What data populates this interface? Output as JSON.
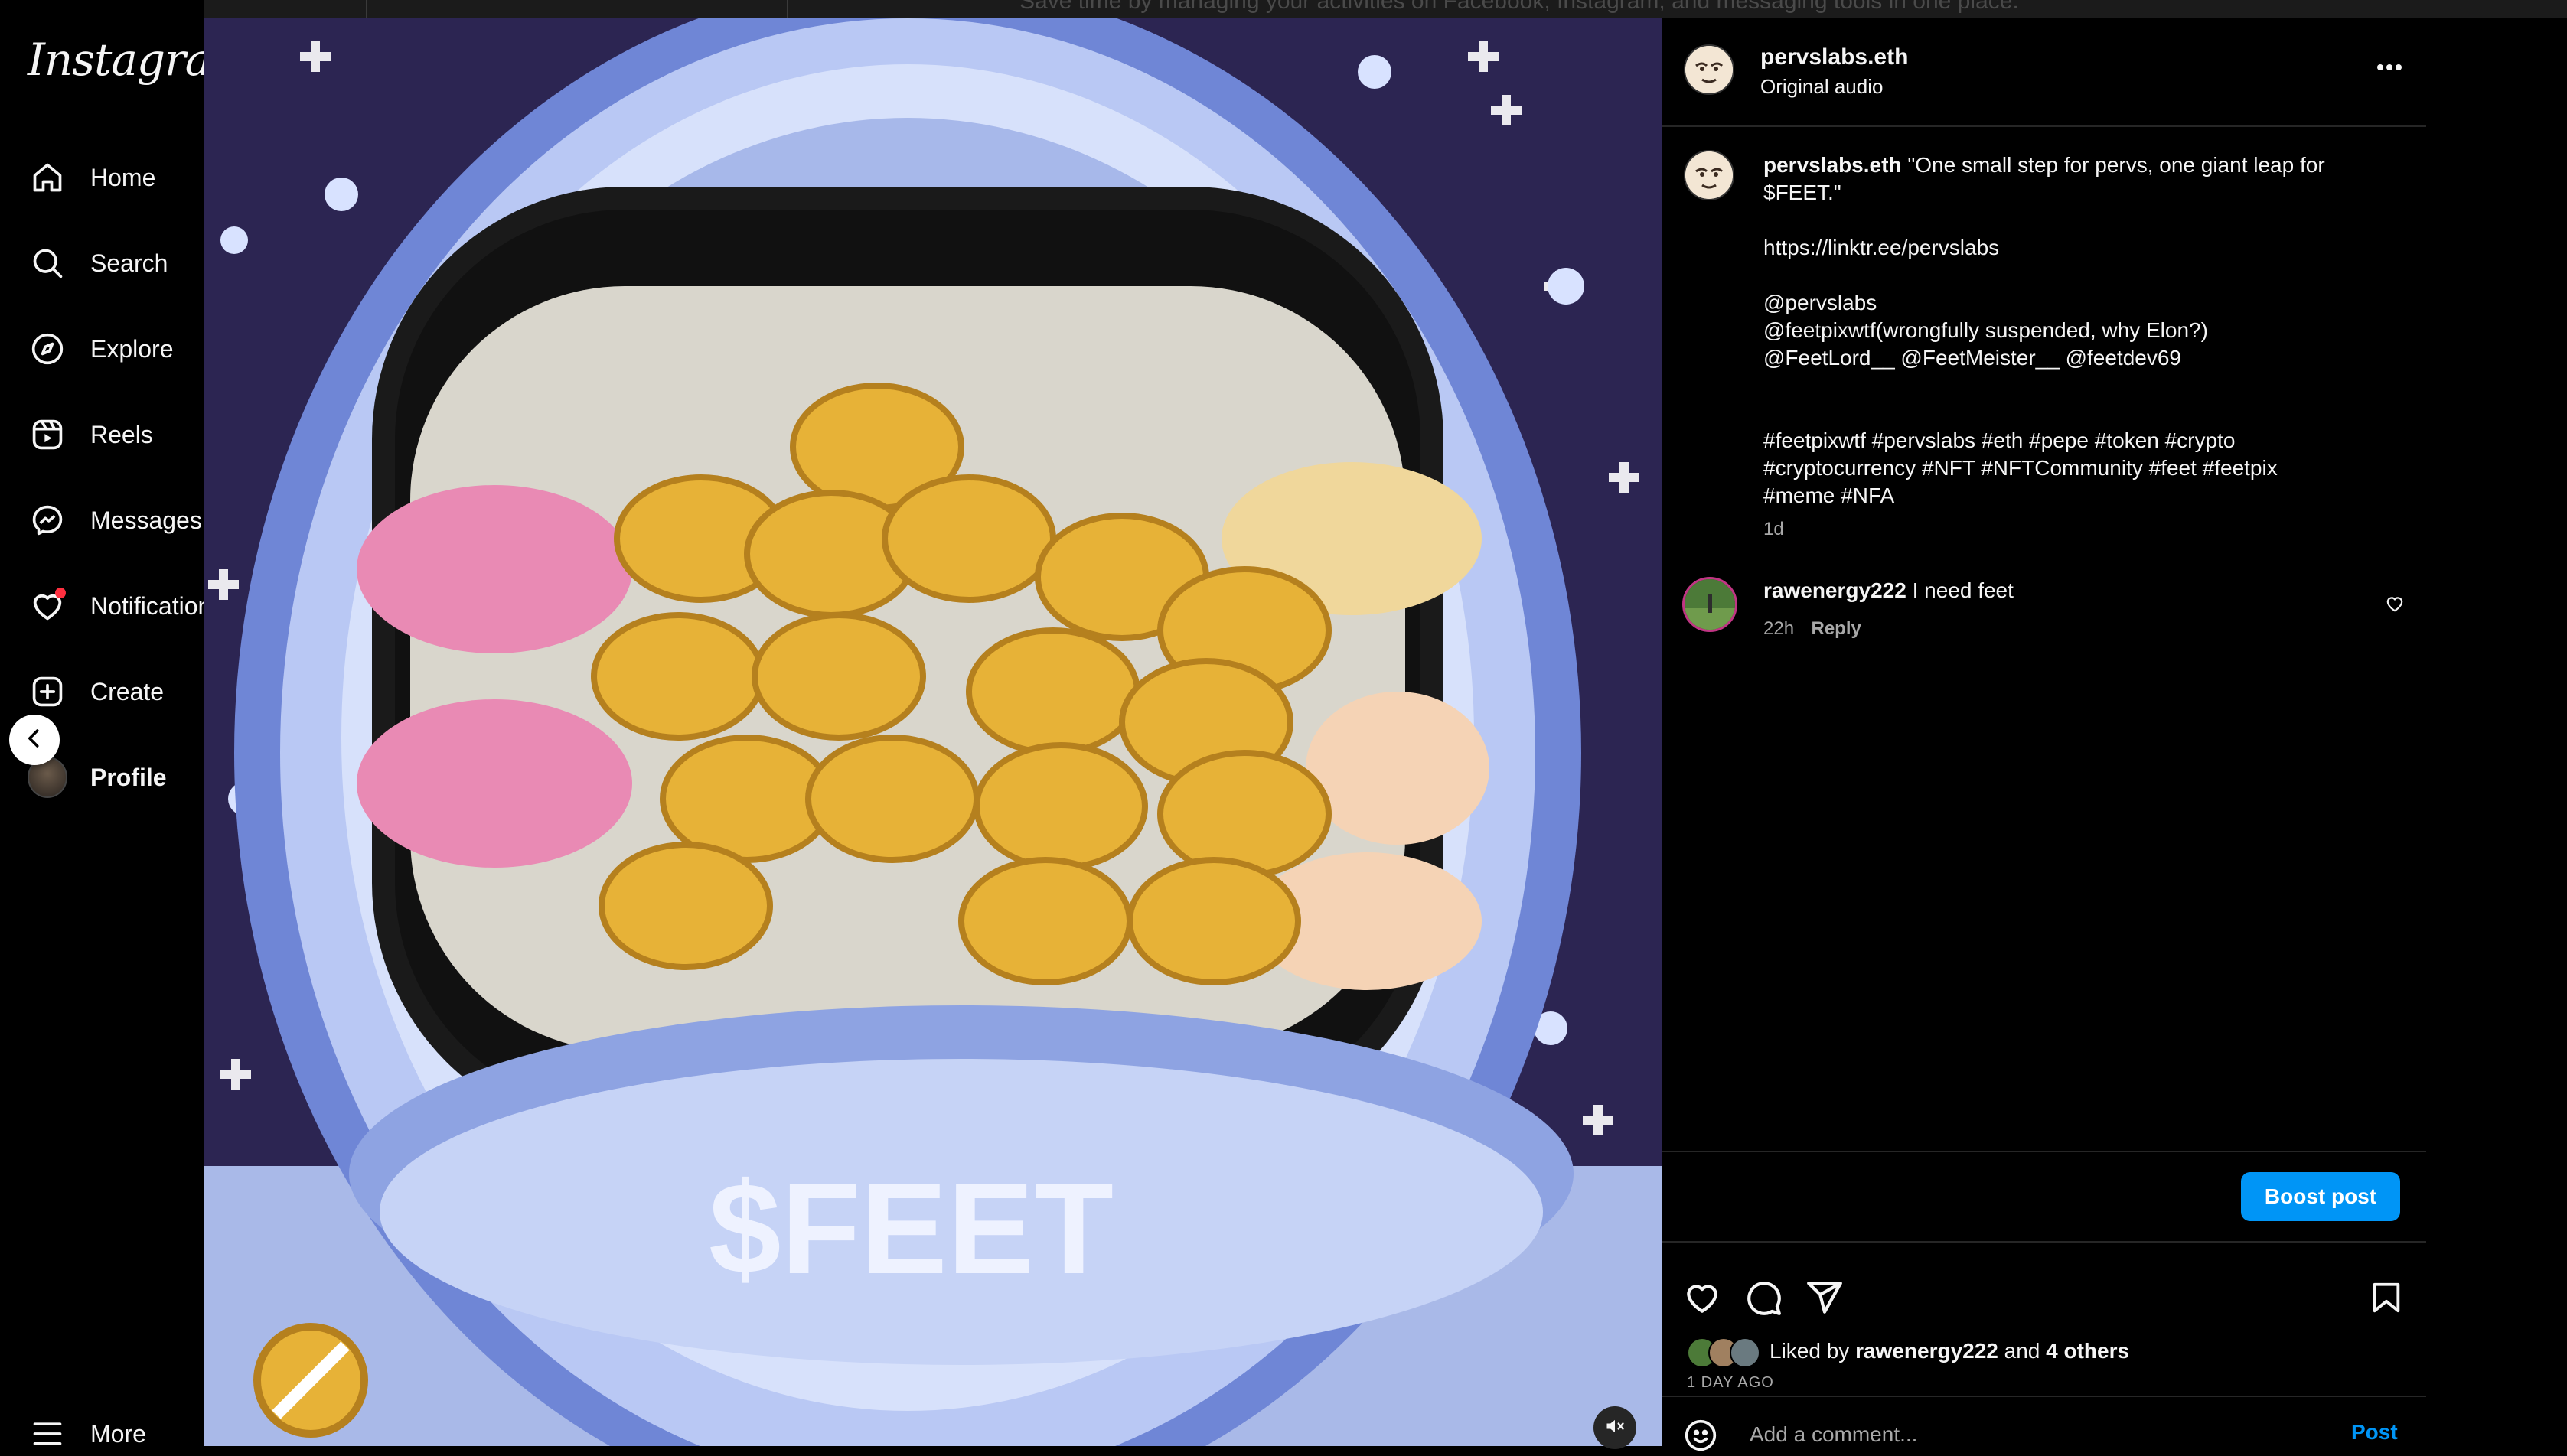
{
  "top_banner": "Save time by managing your activities on Facebook, Instagram, and messaging tools in one place.",
  "sidebar": {
    "logo": "Instagram",
    "items": [
      {
        "label": "Home",
        "icon": "home-icon"
      },
      {
        "label": "Search",
        "icon": "search-icon"
      },
      {
        "label": "Explore",
        "icon": "compass-icon"
      },
      {
        "label": "Reels",
        "icon": "reels-icon"
      },
      {
        "label": "Messages",
        "icon": "messenger-icon"
      },
      {
        "label": "Notifications",
        "icon": "heart-icon"
      },
      {
        "label": "Create",
        "icon": "plus-square-icon"
      },
      {
        "label": "Profile",
        "icon": "avatar"
      }
    ],
    "more_label": "More"
  },
  "media": {
    "overlay_text": "$FEET",
    "muted": true
  },
  "post": {
    "header": {
      "username": "pervslabs.eth",
      "audio": "Original audio"
    },
    "caption": {
      "username": "pervslabs.eth",
      "line1": "\"One small step for pervs, one giant leap for",
      "line2": "$FEET.\"",
      "link": "https://linktr.ee/pervslabs",
      "mention1": "@pervslabs",
      "mention2": "@feetpixwtf(wrongfully suspended, why Elon?)",
      "mention3": "@FeetLord__ @FeetMeister__ @feetdev69",
      "tags1": "#feetpixwtf #pervslabs #eth #pepe #token #crypto",
      "tags2": "#cryptocurrency #NFT #NFTCommunity #feet #feetpix",
      "tags3": "#meme #NFA",
      "time": "1d"
    },
    "comments": [
      {
        "username": "rawenergy222",
        "text": "I need feet",
        "time": "22h",
        "reply_label": "Reply"
      }
    ],
    "boost_label": "Boost post",
    "liked_by_prefix": "Liked by",
    "liked_by_user": "rawenergy222",
    "liked_by_and": "and",
    "liked_by_others": "4 others",
    "time_ago": "1 DAY AGO",
    "comment_placeholder": "Add a comment...",
    "post_label": "Post"
  },
  "colors": {
    "accent": "#0095f6",
    "background": "#000000",
    "notification_dot": "#ff3040"
  }
}
